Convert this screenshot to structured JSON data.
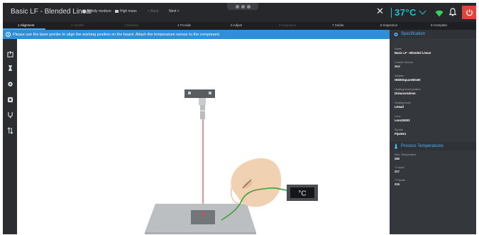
{
  "app": {
    "title": "Basic LF - Blended Linear",
    "chips": [
      "Mostly medium",
      "High mass"
    ],
    "back_label": "< Back",
    "next_label": "Next >"
  },
  "status": {
    "temperature": "37°C",
    "accent_color": "#19c3c8",
    "power_color": "#e0443a"
  },
  "steps": [
    {
      "label": "1 Alignment",
      "state": "active"
    },
    {
      "label": "2 Handle",
      "state": "dim"
    },
    {
      "label": "3 Release",
      "state": "dim"
    },
    {
      "label": "4 Provide",
      "state": "normal"
    },
    {
      "label": "5 Adjust",
      "state": "normal"
    },
    {
      "label": "6 Inspection",
      "state": "dim"
    },
    {
      "label": "7 Solder",
      "state": "normal"
    },
    {
      "label": "8 Inspection",
      "state": "normal"
    },
    {
      "label": "9 Complete",
      "state": "normal"
    }
  ],
  "instruction": "Please use the laser pointer to align the working position on the board. Attach the temperature sensor to the component.",
  "tools": [
    "board-icon",
    "hand-icon",
    "gear-icon",
    "target-icon",
    "solder-iron-icon",
    "swap-arrows-icon"
  ],
  "scene": {
    "display_reading": "°C"
  },
  "specification": {
    "header": "Specification",
    "fields": [
      {
        "label": "Name",
        "value": "Basic LF - Blended Linear"
      },
      {
        "label": "Control Service",
        "value": "SLV"
      },
      {
        "label": "Adapter",
        "value": "HDMISquare60x60"
      },
      {
        "label": "Heating head position",
        "value": "Distance10mm"
      },
      {
        "label": "Heating head",
        "value": "LHead"
      },
      {
        "label": "Lens",
        "value": "Lens25003"
      },
      {
        "label": "Pipette",
        "value": "Pipette1"
      }
    ]
  },
  "process_temperatures": {
    "header": "Process Temperatures",
    "fields": [
      {
        "label": "Max. Temperature",
        "value": "260"
      },
      {
        "label": "T Liquid",
        "value": "217"
      },
      {
        "label": "T Pipette",
        "value": "216"
      }
    ]
  }
}
